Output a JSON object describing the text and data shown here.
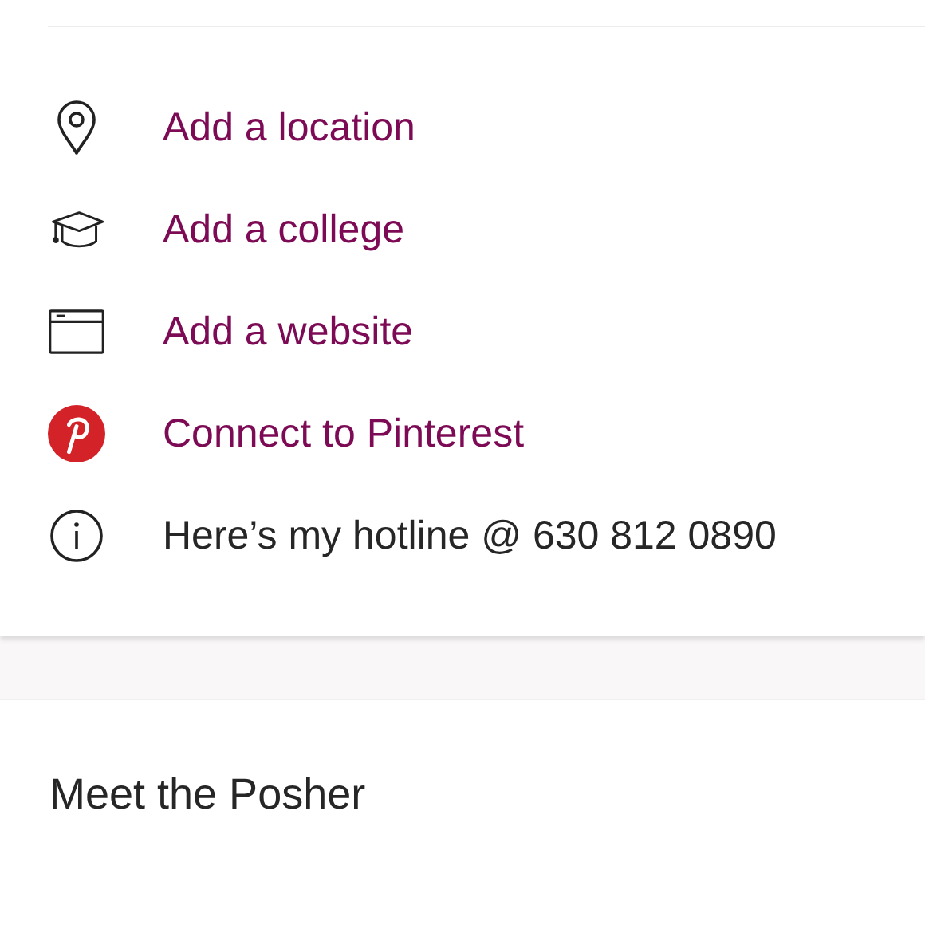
{
  "profile_links": [
    {
      "kind": "location",
      "label": "Add a location"
    },
    {
      "kind": "college",
      "label": "Add a college"
    },
    {
      "kind": "website",
      "label": "Add a website"
    },
    {
      "kind": "pinterest",
      "label": "Connect to Pinterest"
    },
    {
      "kind": "info",
      "label": "Here’s my hotline @ 630 812 0890"
    }
  ],
  "section": {
    "title": "Meet the Posher"
  }
}
